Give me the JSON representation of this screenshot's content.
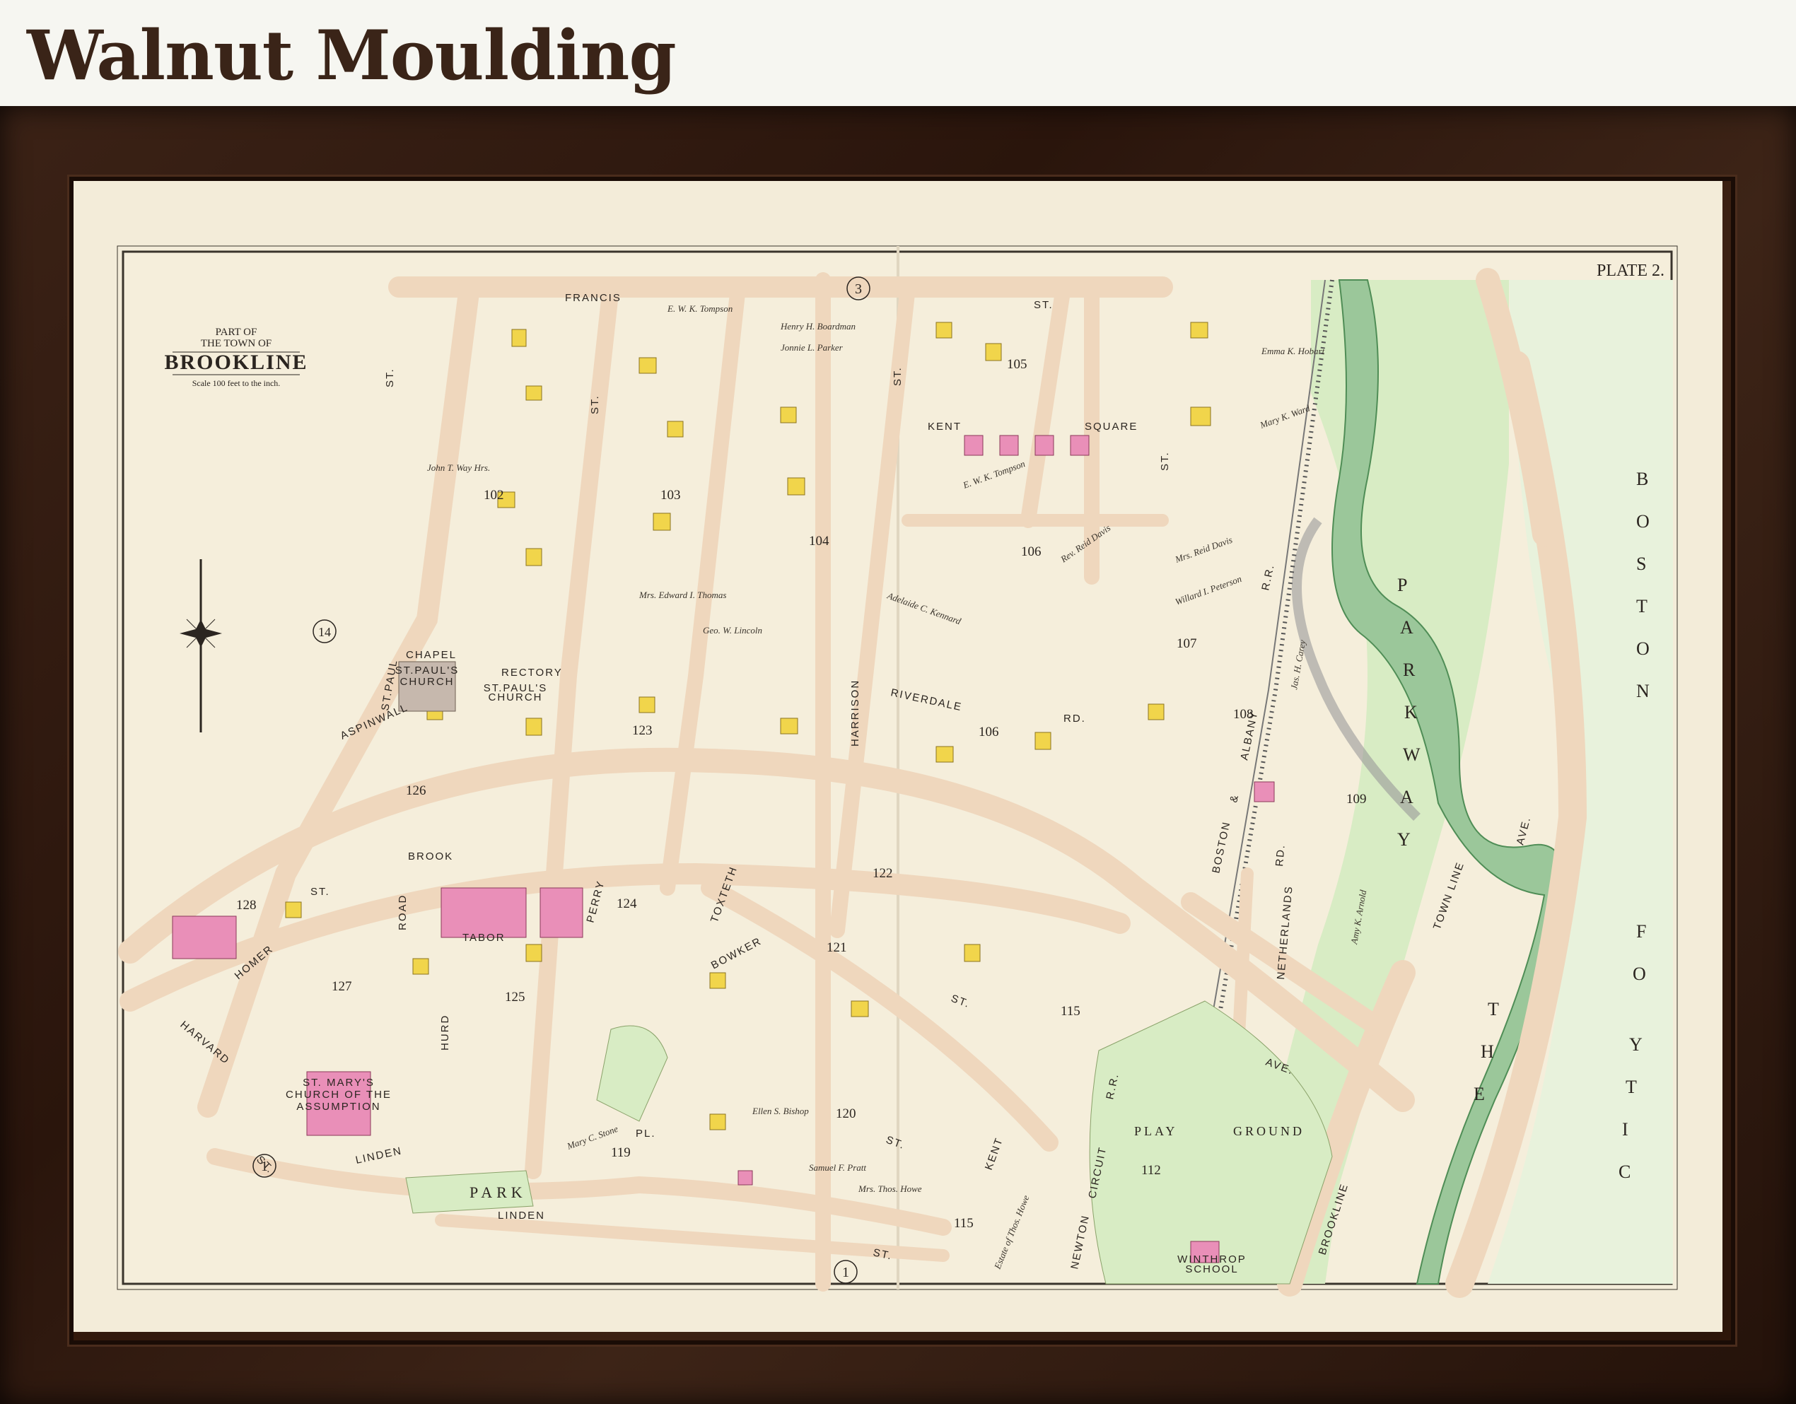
{
  "header": {
    "title": "Walnut Moulding"
  },
  "map": {
    "plate": "PLATE 2.",
    "cartouche": {
      "line1": "PART OF",
      "line2": "THE TOWN OF",
      "line3": "BROOKLINE",
      "scale": "Scale 100 feet to the inch."
    },
    "plate_refs": [
      "3",
      "14",
      "1",
      "1"
    ],
    "streets": [
      "FRANCIS",
      "ST.",
      "KENT",
      "SQUARE",
      "ST.",
      "ST.PAUL",
      "ST.",
      "ST.",
      "ST.",
      "ASPINWALL",
      "RIVERDALE",
      "RD.",
      "HARRISON",
      "BROOK",
      "ST.",
      "HOMER",
      "HARVARD",
      "ROAD",
      "HURD",
      "TABOR",
      "PERRY",
      "TOXTETH",
      "BOWKER",
      "ST.",
      "ST.",
      "KENT",
      "PL.",
      "LINDEN",
      "LINDEN",
      "ST.",
      "ST.",
      "AVE.",
      "NETHERLANDS",
      "RD.",
      "BROOKLINE",
      "AVE.",
      "NEWTON",
      "CIRCUIT",
      "R.R.",
      "BOSTON",
      "&",
      "ALBANY",
      "R.R."
    ],
    "block_numbers": [
      "105",
      "103",
      "104",
      "102",
      "106",
      "107",
      "108",
      "109",
      "126",
      "123",
      "106",
      "128",
      "122",
      "124",
      "121",
      "125",
      "127",
      "119",
      "120",
      "115",
      "115",
      "112"
    ],
    "landmarks": {
      "chapel": "CHAPEL",
      "st_pauls_church": [
        "ST.PAUL'S",
        "CHURCH"
      ],
      "rectory": "RECTORY",
      "st_pauls_church_small": [
        "ST.PAUL'S",
        "CHURCH"
      ],
      "st_marys": [
        "ST. MARY'S",
        "CHURCH OF THE",
        "ASSUMPTION"
      ],
      "park": "PARK",
      "play_ground": [
        "PLAY",
        "GROUND"
      ],
      "winthrop_school": [
        "WINTHROP",
        "SCHOOL"
      ],
      "parkway": [
        "P",
        "A",
        "R",
        "K",
        "W",
        "A",
        "Y"
      ],
      "the": [
        "T",
        "H",
        "E"
      ],
      "city_of": [
        "C",
        "I",
        "T",
        "Y",
        "O",
        "F"
      ],
      "boston": [
        "B",
        "O",
        "S",
        "T",
        "O",
        "N"
      ],
      "town_line": "TOWN LINE"
    },
    "owners": [
      "E. W. K. Tompson",
      "Henry H. Boardman",
      "Jonnie L. Parker",
      "Emma K. Hobart",
      "Mary K. Ward",
      "E. W. K. Tompson",
      "Rev. Reid Davis",
      "Adelaide C. Kennard",
      "Mrs. Reid Davis",
      "Willard I. Peterson",
      "Jas. H. Carey",
      "Amy K. Arnold",
      "John T. Way Hrs.",
      "Mrs. Edward I. Thomas",
      "Geo. W. Lincoln",
      "Mary C. Stone",
      "Ellen S. Bishop",
      "Samuel F. Pratt",
      "Mrs. Thos. Howe",
      "Estate of Thos. Howe"
    ],
    "colors": {
      "paper": "#f3ecd9",
      "road": "#efd7bd",
      "brick_building": "#e98fb8",
      "frame_building": "#f1d54b",
      "park": "#d8ecc4",
      "river": "#9bc79a",
      "frame": "#2a150c"
    }
  }
}
